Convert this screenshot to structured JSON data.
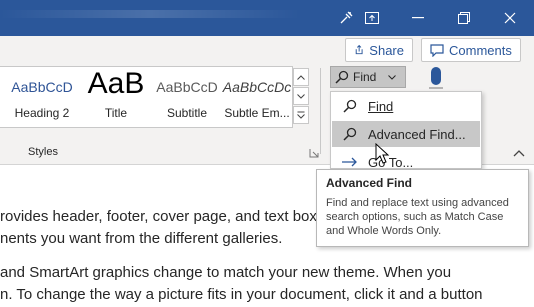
{
  "ribbon": {
    "share_label": "Share",
    "comments_label": "Comments",
    "styles": [
      {
        "sample": "AaBbCcD",
        "name": "Heading 2"
      },
      {
        "sample": "AaB",
        "name": "Title"
      },
      {
        "sample": "AaBbCcD",
        "name": "Subtitle"
      },
      {
        "sample": "AaBbCcDc",
        "name": "Subtle Em..."
      }
    ],
    "styles_group_label": "Styles",
    "find_label": "Find"
  },
  "find_menu": {
    "items": [
      {
        "label": "Find",
        "icon": "search-icon"
      },
      {
        "label": "Advanced Find...",
        "icon": "search-icon"
      },
      {
        "label": "Go To...",
        "icon": "arrow-right-icon"
      }
    ]
  },
  "tooltip": {
    "title": "Advanced Find",
    "body": "Find and replace text using advanced search options, such as Match Case and Whole Words Only."
  },
  "document": {
    "lines": [
      "rovides header, footer, cover page, and text box",
      "nents you want from the different galleries.",
      "and SmartArt graphics change to match your new theme. When you",
      "n. To change the way a picture fits in your document, click it and a button"
    ]
  },
  "colors": {
    "titlebar": "#2b579a",
    "accent_text": "#2b579a",
    "hover": "#c8c8c8"
  }
}
